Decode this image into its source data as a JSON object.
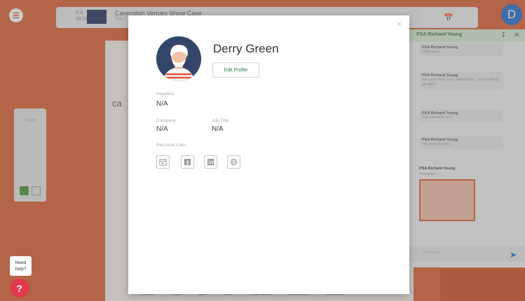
{
  "topbar": {
    "time_line1": "2:3",
    "time_line2": "00:18:5s",
    "title": "Cavendish Venues Show Case",
    "subtitle": "Day 1",
    "calendar_icon": "calendar-icon"
  },
  "user": {
    "avatar_letter": "D"
  },
  "left_panel": {
    "title": "Filter"
  },
  "stage": {
    "logo_text": "ca"
  },
  "chat": {
    "header": "PSA Richard Young",
    "messages": [
      {
        "who": "PSA Richard Young",
        "text": "Hello guys"
      },
      {
        "who": "PSA Richard Young",
        "text": "We can't hear your video/audio, is everything all right?"
      },
      {
        "who": "PSA Richard Young",
        "text": "You can hear me?"
      },
      {
        "who": "PSA Richard Young",
        "text": "OK great thanks"
      },
      {
        "who": "PSA Richard Young",
        "text": "Floorplan"
      }
    ],
    "input_placeholder": "Message..."
  },
  "help": {
    "bubble_line1": "Need",
    "bubble_line2": "help?"
  },
  "bottom_nav": [
    "Go Live",
    "Team",
    "Q&A",
    "Chat",
    "Show Room",
    "Dashboard",
    "Exhibitors"
  ],
  "profile": {
    "name": "Derry Green",
    "edit_label": "Edit Profile",
    "headline_label": "Headline",
    "headline_value": "N/A",
    "company_label": "Company",
    "company_value": "N/A",
    "jobtitle_label": "Job Title",
    "jobtitle_value": "N/A",
    "social_label": "Personal Links",
    "social_icons": [
      "calendar-icon",
      "facebook-icon",
      "linkedin-icon",
      "globe-icon"
    ]
  }
}
